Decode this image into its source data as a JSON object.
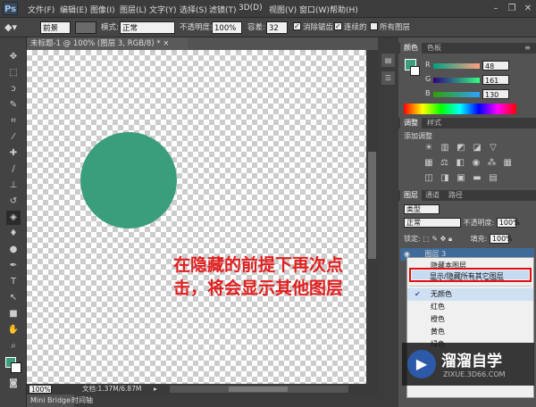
{
  "app": {
    "logo": "Ps"
  },
  "menu": [
    "文件(F)",
    "编辑(E)",
    "图像(I)",
    "图层(L)",
    "文字(Y)",
    "选择(S)",
    "滤镜(T)",
    "3D(D)",
    "视图(V)",
    "窗口(W)",
    "帮助(H)"
  ],
  "options": {
    "preset": "前景",
    "mode_label": "模式:",
    "mode": "正常",
    "opacity_label": "不透明度:",
    "opacity": "100%",
    "tolerance_label": "容差:",
    "tolerance": "32",
    "antialias": "消除锯齿",
    "contiguous": "连续的",
    "all_layers": "所有图层"
  },
  "document": {
    "tab": "未标题-1 @ 100% (图层 3, RGB/8) *",
    "zoom": "100%",
    "doc_info": "文档:1.37M/6.87M",
    "circle_color": "#3a9e7d"
  },
  "annotation": {
    "line1": "在隐藏的前提下再次点",
    "line2": "击，将会显示其他图层"
  },
  "bottom_tabs": [
    "Mini Bridge",
    "时间轴"
  ],
  "color_panel": {
    "tabs": [
      "颜色",
      "色板"
    ],
    "r_label": "R",
    "r": "48",
    "g_label": "G",
    "g": "161",
    "b_label": "B",
    "b": "130"
  },
  "adjust_panel": {
    "tabs": [
      "调整",
      "样式"
    ],
    "title": "添加调整"
  },
  "layers_panel": {
    "tabs": [
      "图层",
      "通道",
      "路径"
    ],
    "kind": "类型",
    "blend": "正常",
    "opacity_label": "不透明度:",
    "opacity": "100%",
    "lock_label": "锁定:",
    "fill_label": "填充:",
    "fill": "100%",
    "layer_name": "图层 3"
  },
  "context_menu": {
    "items": [
      "隐藏本图层",
      "显示/隐藏所有其它图层",
      "无颜色",
      "红色",
      "橙色",
      "黄色",
      "绿色"
    ]
  },
  "watermark": {
    "name": "溜溜自学",
    "url": "ZIXUE.3D66.COM"
  }
}
